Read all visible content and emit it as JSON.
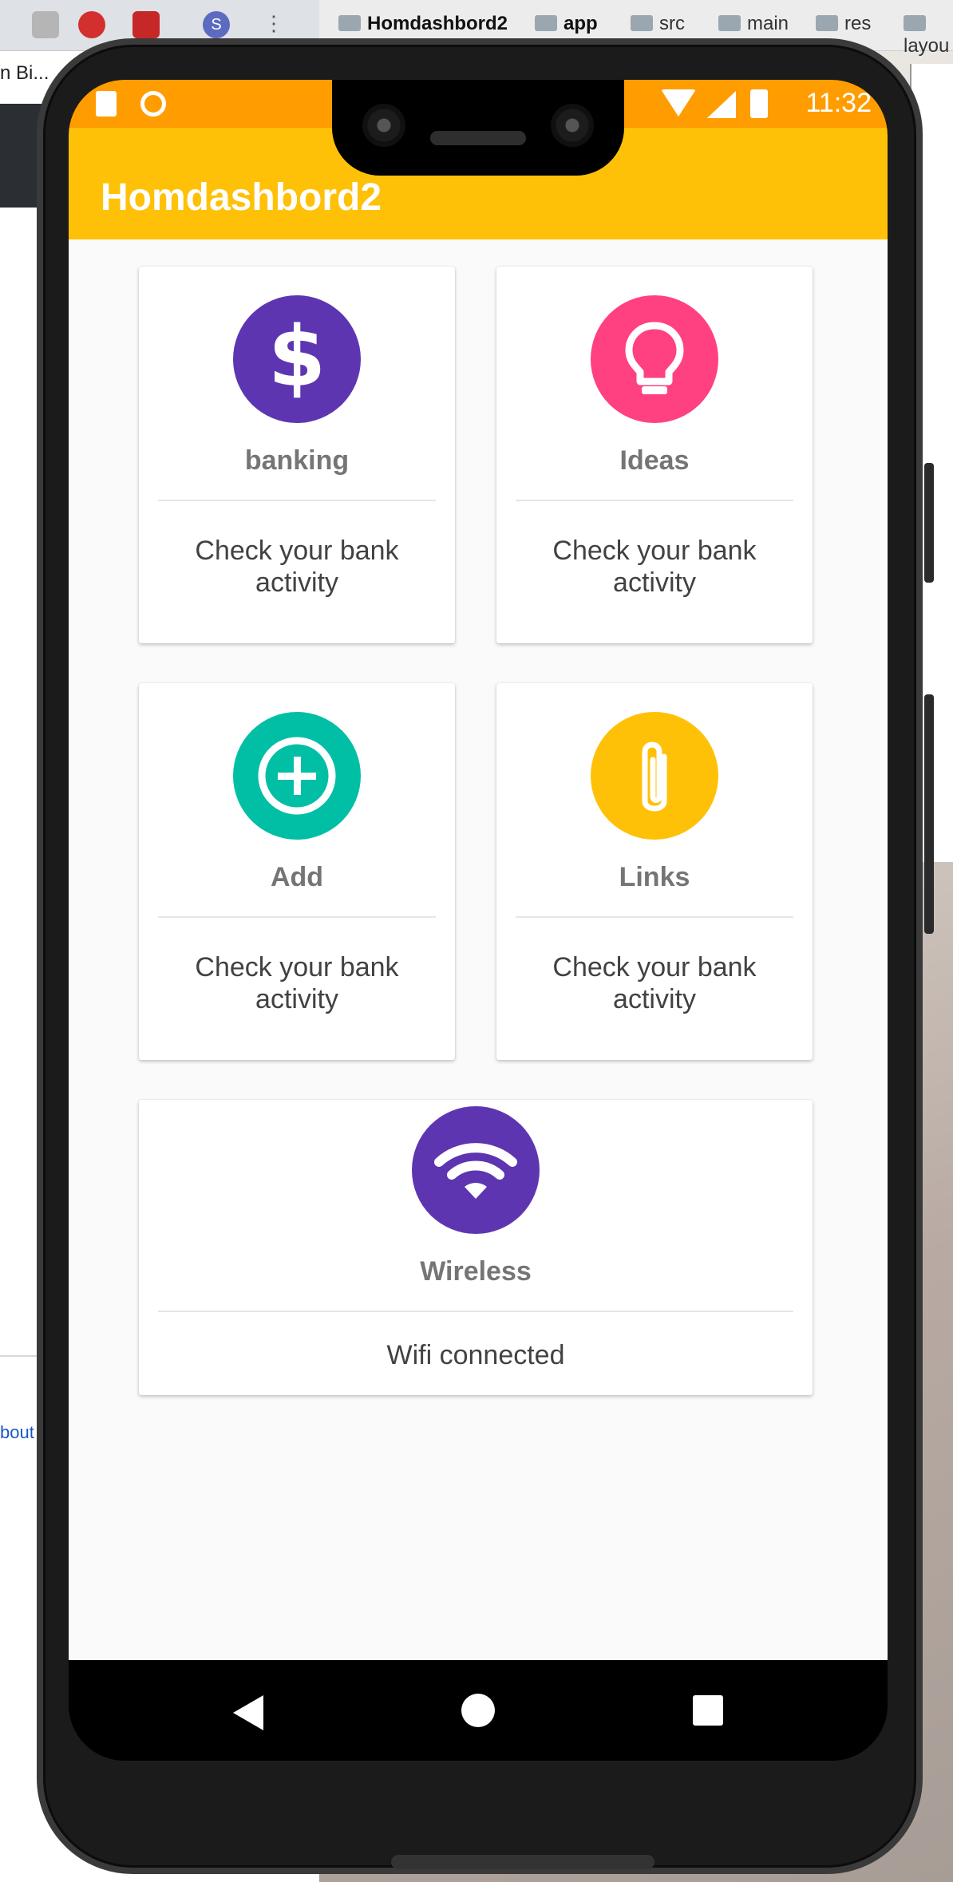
{
  "browser": {
    "tab_text": "n Bi...",
    "profile_initial": "S",
    "more_icon": "kebab-icon",
    "about_link": "bout"
  },
  "ide": {
    "breadcrumbs": [
      {
        "label": "Homdashbord2",
        "bold": true
      },
      {
        "label": "app",
        "bold": true
      },
      {
        "label": "src",
        "bold": false
      },
      {
        "label": "main",
        "bold": false
      },
      {
        "label": "res",
        "bold": false
      },
      {
        "label": "layou",
        "bold": false
      }
    ]
  },
  "status_bar": {
    "time": "11:32",
    "icons": [
      "sd-card-icon",
      "sync-icon",
      "wifi-icon",
      "signal-icon",
      "battery-icon"
    ]
  },
  "app_bar": {
    "title": "Homdashbord2"
  },
  "cards": [
    {
      "id": "banking",
      "title": "banking",
      "description": "Check your bank activity",
      "icon": "dollar-icon",
      "color": "#5e35b1"
    },
    {
      "id": "ideas",
      "title": "Ideas",
      "description": "Check your bank activity",
      "icon": "lightbulb-icon",
      "color": "#ff4081"
    },
    {
      "id": "add",
      "title": "Add",
      "description": "Check your bank activity",
      "icon": "add-circle-icon",
      "color": "#00bfa5"
    },
    {
      "id": "links",
      "title": "Links",
      "description": "Check your bank activity",
      "icon": "paperclip-icon",
      "color": "#ffc107"
    },
    {
      "id": "wireless",
      "title": "Wireless",
      "description": "Wifi connected",
      "icon": "wifi-icon",
      "color": "#5e35b1"
    }
  ],
  "nav_bar": {
    "buttons": [
      "back-icon",
      "home-icon",
      "recents-icon"
    ]
  },
  "colors": {
    "status_bar": "#ff9d00",
    "app_bar": "#ffc107",
    "card_title": "#757575",
    "card_text": "#424242"
  }
}
